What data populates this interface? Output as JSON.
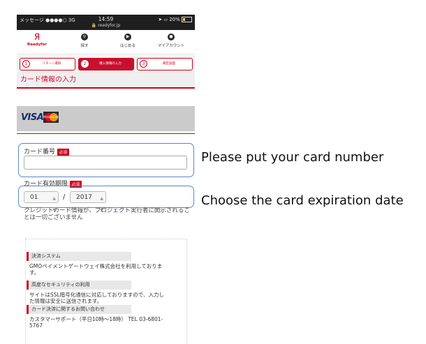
{
  "status_bar": {
    "carrier": "メッセージ ●●●●○ 3G",
    "time": "14:59",
    "url": "readyfor.jp",
    "battery": "20%"
  },
  "nav": {
    "logo": "Readyfor",
    "items": [
      {
        "label": "探す",
        "icon": "search-icon"
      },
      {
        "label": "はじめる",
        "icon": "play-icon"
      },
      {
        "label": "マイアカウント",
        "icon": "user-icon"
      }
    ]
  },
  "steps": [
    {
      "num": "1",
      "label": "リターン選択"
    },
    {
      "num": "2",
      "label": "購入情報の入力"
    },
    {
      "num": "3",
      "label": "確定画面"
    }
  ],
  "section_title": "カード情報の入力",
  "card_brands": {
    "visa": "VISA",
    "mastercard": "MasterCard"
  },
  "form": {
    "card_number_label": "カード番号",
    "required_badge": "必須",
    "card_number_value": "",
    "expiry_label": "カード有効期限",
    "expiry_month": "01",
    "expiry_separator": "/",
    "expiry_year": "2017"
  },
  "note": "クレジットカード情報が、プロジェクト実行者に開示されることは一切ございません",
  "info": [
    {
      "heading": "決済システム",
      "text": "GMOペイメントゲートウェイ株式会社を利用しております。"
    },
    {
      "heading": "高度なセキュリティの利用",
      "text": "サイトはSSL暗号化通信に対応しておりますので、入力した情報は安全に送信されます。"
    },
    {
      "heading": "カード決済に関するお問い合わせ",
      "text": "カスタマーサポート（平日10時〜18時） TEL 03-6801-5767"
    }
  ],
  "callouts": {
    "card_number": "Please put your card number",
    "expiry": "Choose the card expiration date"
  },
  "colors": {
    "accent": "#d0021b",
    "highlight": "#5b86c5"
  }
}
